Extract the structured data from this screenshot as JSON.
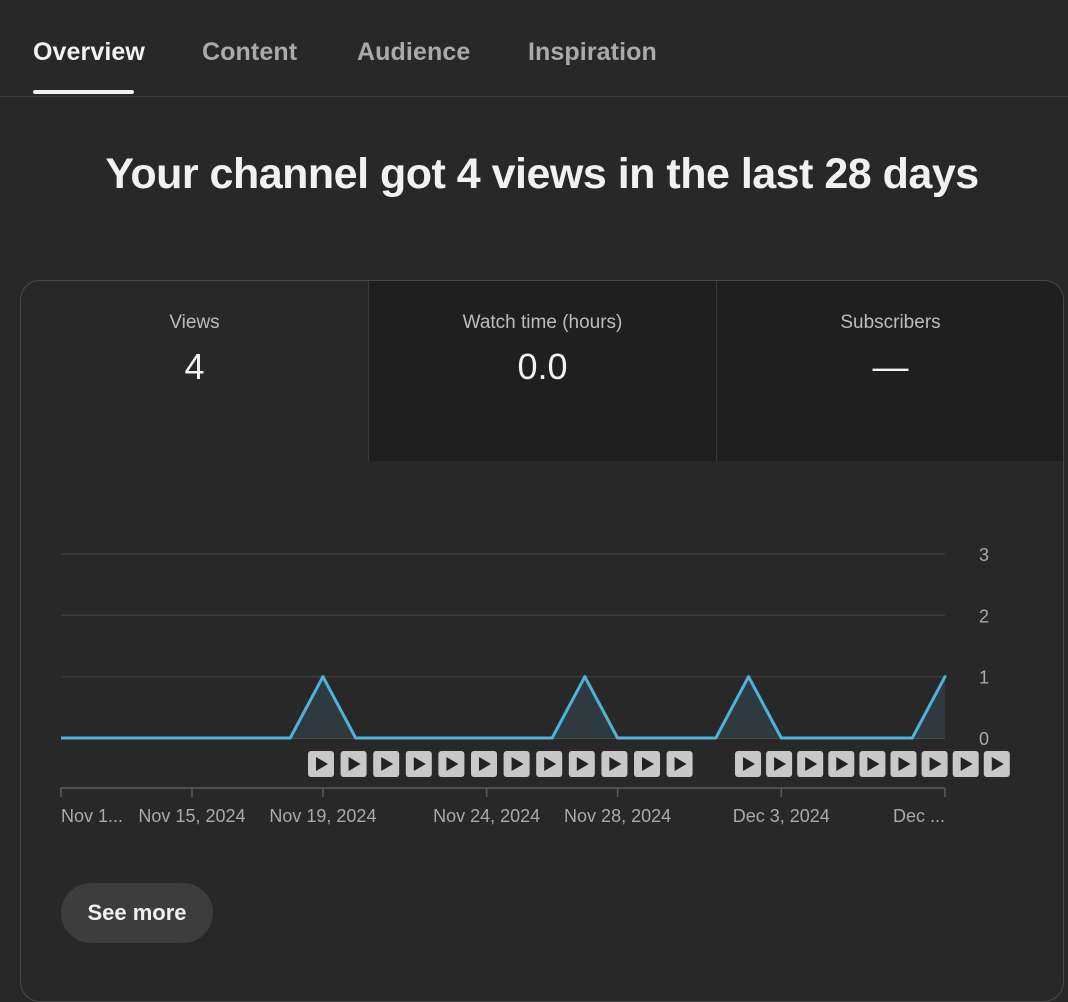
{
  "tabs": [
    {
      "label": "Overview",
      "active": true
    },
    {
      "label": "Content",
      "active": false
    },
    {
      "label": "Audience",
      "active": false
    },
    {
      "label": "Inspiration",
      "active": false
    }
  ],
  "headline": "Your channel got 4 views in the last 28 days",
  "metrics": [
    {
      "label": "Views",
      "value": "4"
    },
    {
      "label": "Watch time (hours)",
      "value": "0.0"
    },
    {
      "label": "Subscribers",
      "value": "—"
    }
  ],
  "chart_data": {
    "type": "line",
    "x": [
      "Nov 11",
      "Nov 12",
      "Nov 13",
      "Nov 14",
      "Nov 15",
      "Nov 16",
      "Nov 17",
      "Nov 18",
      "Nov 19",
      "Nov 20",
      "Nov 21",
      "Nov 22",
      "Nov 23",
      "Nov 24",
      "Nov 25",
      "Nov 26",
      "Nov 27",
      "Nov 28",
      "Nov 29",
      "Nov 30",
      "Dec 1",
      "Dec 2",
      "Dec 3",
      "Dec 4",
      "Dec 5",
      "Dec 6",
      "Dec 7",
      "Dec 8"
    ],
    "series": [
      {
        "values": [
          0,
          0,
          0,
          0,
          0,
          0,
          0,
          0,
          1,
          0,
          0,
          0,
          0,
          0,
          0,
          0,
          1,
          0,
          0,
          0,
          0,
          1,
          0,
          0,
          0,
          0,
          0,
          1
        ]
      }
    ],
    "x_tick_labels": [
      "Nov 1...",
      "Nov 15, 2024",
      "Nov 19, 2024",
      "Nov 24, 2024",
      "Nov 28, 2024",
      "Dec 3, 2024",
      "Dec ..."
    ],
    "y_ticks": [
      "0",
      "1",
      "2",
      "3"
    ],
    "ylim": [
      0,
      3
    ],
    "grid": true,
    "line_color": "#4fb3d9",
    "fill_color": "#2f3a40",
    "video_marker_days": [
      "Nov 19",
      "Nov 20",
      "Nov 21",
      "Nov 22",
      "Nov 23",
      "Nov 24",
      "Nov 25",
      "Nov 26",
      "Nov 27",
      "Nov 28",
      "Nov 29",
      "Nov 30",
      "Dec 3",
      "Dec 4",
      "Dec 5",
      "Dec 6",
      "Dec 7",
      "Dec 8",
      "Dec 9",
      "Dec 10",
      "Dec 11"
    ]
  },
  "see_more_label": "See more",
  "colors": {
    "background": "#282828",
    "accent_line": "#4fb3d9",
    "card_border": "#4a4a4a"
  }
}
